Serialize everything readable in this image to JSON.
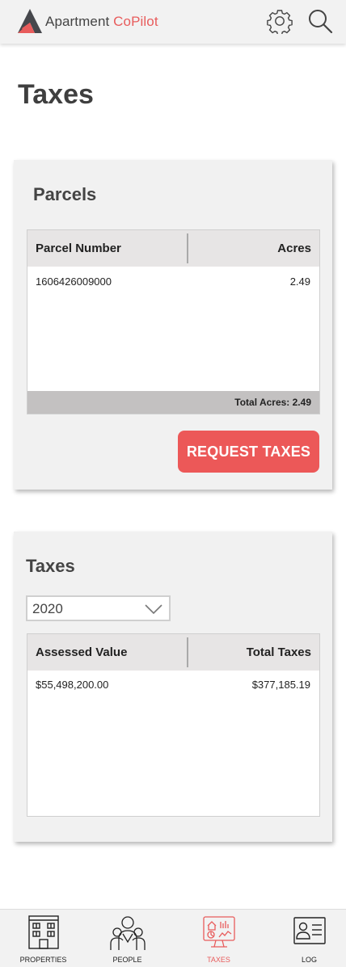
{
  "header": {
    "app_name_part1": "Apartment ",
    "app_name_part2": "CoPilot",
    "settings_icon": "gear-icon",
    "search_icon": "search-icon",
    "accent_color": "#e85c5c"
  },
  "page": {
    "title": "Taxes"
  },
  "parcels": {
    "title": "Parcels",
    "columns": [
      "Parcel Number",
      "Acres"
    ],
    "rows": [
      {
        "parcel_number": "1606426009000",
        "acres": "2.49"
      }
    ],
    "footer": "Total Acres: 2.49",
    "request_button": "REQUEST TAXES",
    "button_color": "#ec5858"
  },
  "taxes": {
    "title": "Taxes",
    "year_selected": "2020",
    "columns": [
      "Assessed Value",
      "Total Taxes"
    ],
    "rows": [
      {
        "assessed_value": "$55,498,200.00",
        "total_taxes": "$377,185.19"
      }
    ]
  },
  "nav": {
    "items": [
      {
        "label": "PROPERTIES",
        "icon": "building-icon",
        "active": false
      },
      {
        "label": "PEOPLE",
        "icon": "people-icon",
        "active": false
      },
      {
        "label": "TAXES",
        "icon": "taxes-dashboard-icon",
        "active": true
      },
      {
        "label": "LOG",
        "icon": "log-id-card-icon",
        "active": false
      }
    ]
  }
}
